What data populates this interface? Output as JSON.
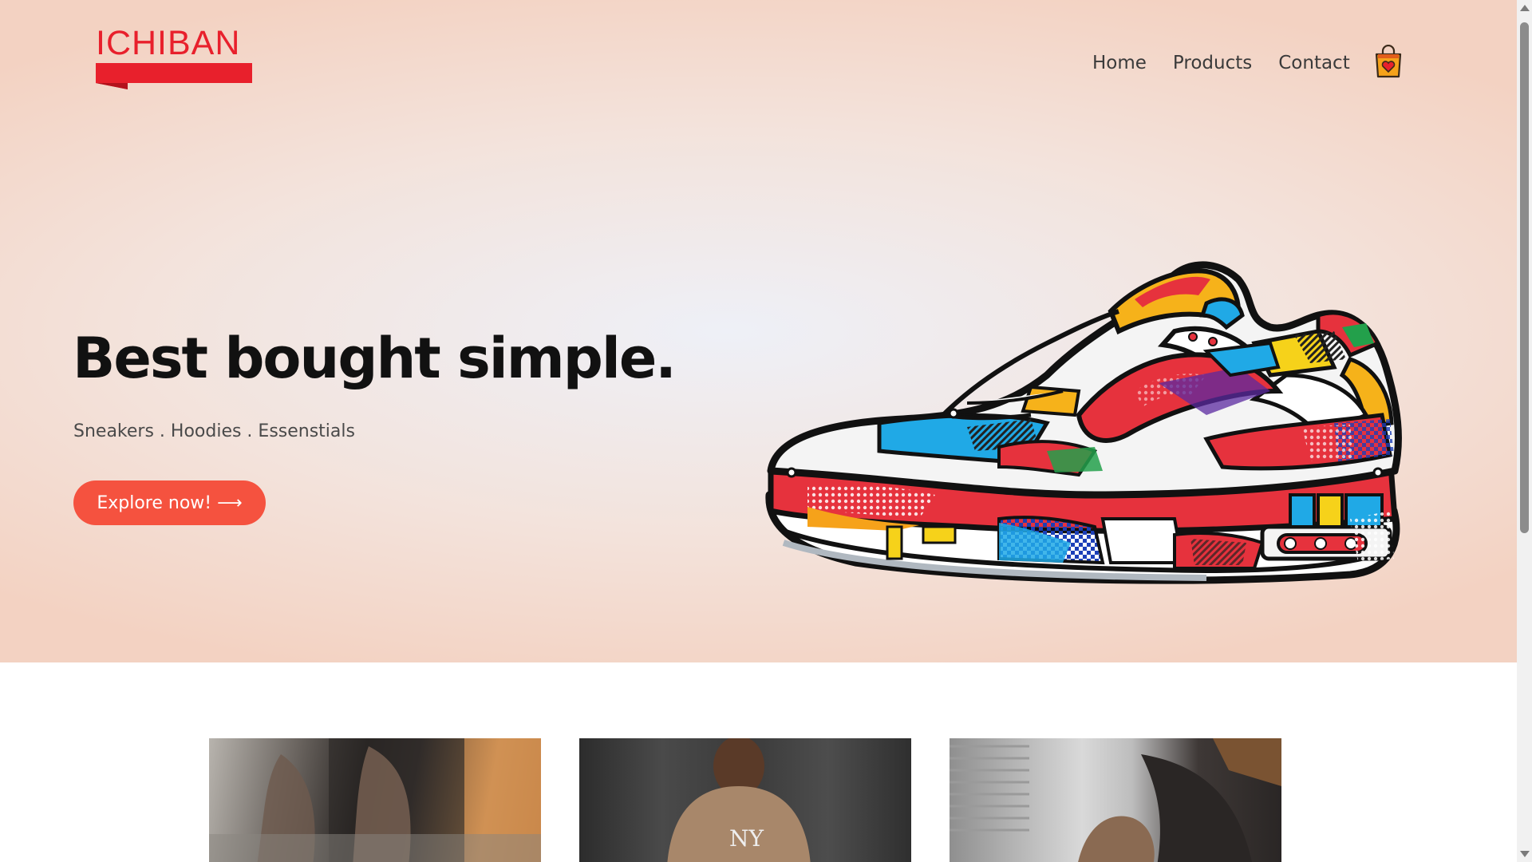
{
  "brand": {
    "name": "ICHIBAN",
    "color": "#e8202c"
  },
  "nav": {
    "items": [
      {
        "label": "Home"
      },
      {
        "label": "Products"
      },
      {
        "label": "Contact"
      }
    ],
    "cart_icon": "shopping-bag-heart-icon"
  },
  "hero": {
    "headline": "Best bought simple.",
    "tagline": "Sneakers . Hoodies . Essenstials",
    "cta_label": "Explore now! ⟶",
    "cta_color": "#f5523f",
    "image": "colorful-sneaker-illustration"
  },
  "products": [
    {
      "image": "tattooed-man-sitting-photo"
    },
    {
      "image": "man-in-ny-hoodie-photo"
    },
    {
      "image": "woman-with-handbag-photo"
    }
  ]
}
